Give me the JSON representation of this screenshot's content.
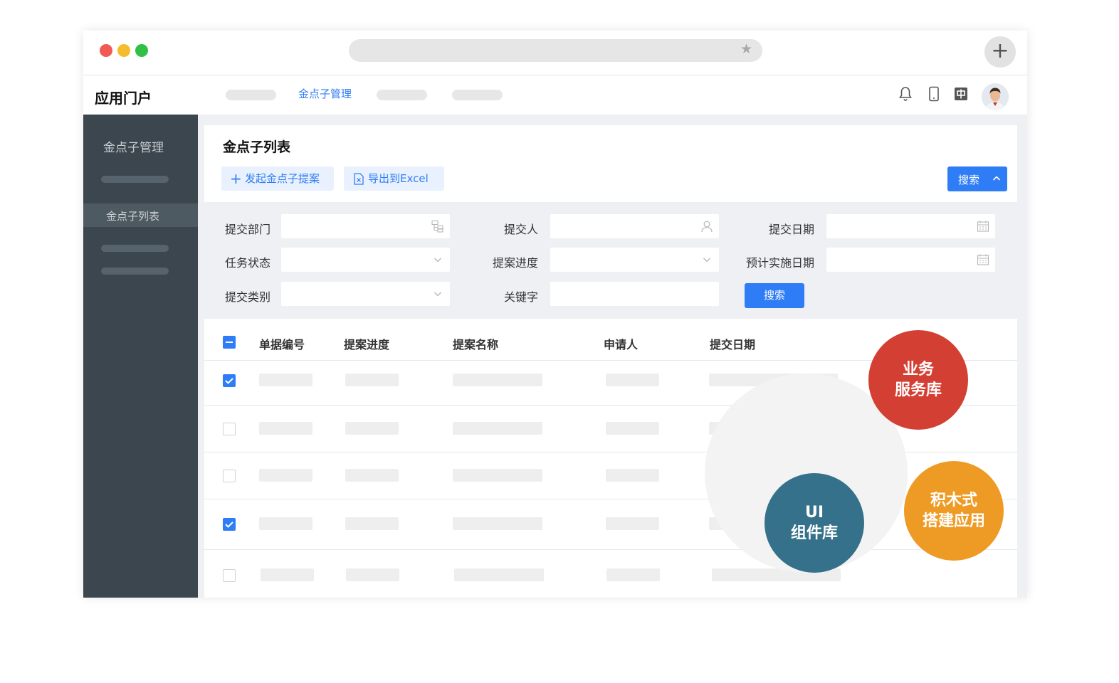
{
  "brand": "应用门户",
  "nav": {
    "active_tab": "金点子管理"
  },
  "sidebar": {
    "title": "金点子管理",
    "active_item": "金点子列表"
  },
  "page": {
    "title": "金点子列表",
    "new_button": "发起金点子提案",
    "export_button": "导出到Excel",
    "search_toggle": "搜索"
  },
  "filters": {
    "dept_label": "提交部门",
    "submitter_label": "提交人",
    "date_label": "提交日期",
    "status_label": "任务状态",
    "progress_label": "提案进度",
    "planned_date_label": "预计实施日期",
    "category_label": "提交类别",
    "keyword_label": "关键字",
    "search_button": "搜索"
  },
  "table": {
    "columns": [
      "单据编号",
      "提案进度",
      "提案名称",
      "申请人",
      "提交日期"
    ],
    "rows": [
      {
        "checked": true
      },
      {
        "checked": false
      },
      {
        "checked": false
      },
      {
        "checked": true
      },
      {
        "checked": false
      }
    ]
  },
  "features": {
    "business": [
      "业务",
      "服务库"
    ],
    "ui": [
      "UI",
      "组件库"
    ],
    "blocks": [
      "积木式",
      "搭建应用"
    ]
  },
  "colors": {
    "accent": "#2f7df6",
    "sidebar": "#3b464e",
    "business": "#d43f33",
    "ui": "#36718b",
    "blocks": "#ee9b26"
  }
}
